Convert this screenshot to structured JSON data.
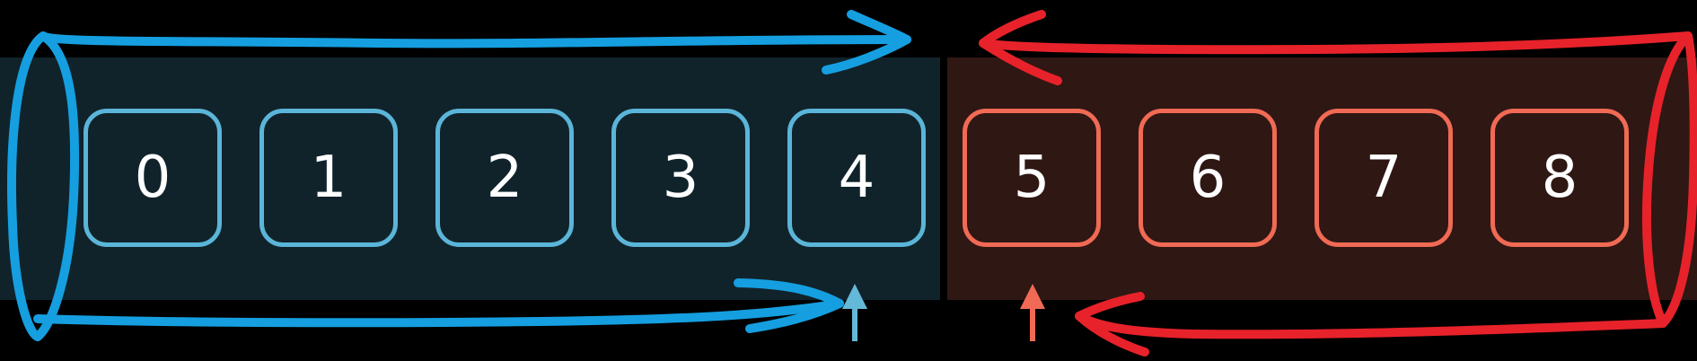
{
  "colors": {
    "background": "#000000",
    "left_panel": "#10232b",
    "right_panel": "#2f1713",
    "left_cell_border": "#5bb5d8",
    "right_cell_border": "#f06a55",
    "blue_stroke": "#159fe0",
    "red_stroke": "#e8222a",
    "left_pointer": "#64b8d8",
    "right_pointer": "#f06a55",
    "text": "#ffffff"
  },
  "cells": [
    {
      "label": "0",
      "group": "left"
    },
    {
      "label": "1",
      "group": "left"
    },
    {
      "label": "2",
      "group": "left"
    },
    {
      "label": "3",
      "group": "left"
    },
    {
      "label": "4",
      "group": "left"
    },
    {
      "label": "5",
      "group": "right"
    },
    {
      "label": "6",
      "group": "right"
    },
    {
      "label": "7",
      "group": "right"
    },
    {
      "label": "8",
      "group": "right"
    }
  ],
  "pointers": [
    {
      "name": "left-pointer-arrow-icon",
      "group": "left"
    },
    {
      "name": "right-pointer-arrow-icon",
      "group": "right"
    }
  ]
}
